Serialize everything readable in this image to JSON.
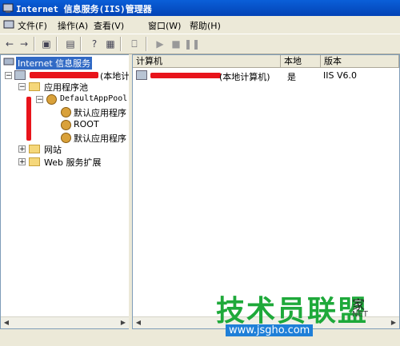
{
  "window": {
    "title": "Internet 信息服务(IIS)管理器"
  },
  "menu": {
    "items": [
      {
        "label": "文件(F)"
      },
      {
        "label": "操作(A)"
      },
      {
        "label": "查看(V)"
      },
      {
        "label": "窗口(W)"
      },
      {
        "label": "帮助(H)"
      }
    ]
  },
  "toolbar": {
    "icons": [
      "back-icon",
      "forward-icon",
      "show-hide-tree-icon",
      "export-list-icon",
      "help-icon",
      "properties-icon",
      "computer-icon",
      "play-icon",
      "stop-icon",
      "pause-icon"
    ]
  },
  "tree": {
    "root": "Internet 信息服务",
    "computer_suffix": "(本地计",
    "app_pools": "应用程序池",
    "default_pool": "DefaultAppPool",
    "pool_children": [
      "默认应用程序",
      "ROOT",
      "默认应用程序"
    ],
    "websites": "网站",
    "web_ext": "Web 服务扩展"
  },
  "list": {
    "headers": [
      "计算机",
      "本地",
      "版本"
    ],
    "row": {
      "computer_suffix": "(本地计算机)",
      "local": "是",
      "version": "IIS V6.0"
    }
  },
  "watermark": {
    "big": "技术员联盟",
    "extra": "家",
    "net": "NET",
    "url": "www.jsgho.com"
  },
  "colors": {
    "title": "#0a5fd8",
    "selection": "#316ac5",
    "redaction": "#e8141b",
    "watermark": "#1ea93a"
  }
}
